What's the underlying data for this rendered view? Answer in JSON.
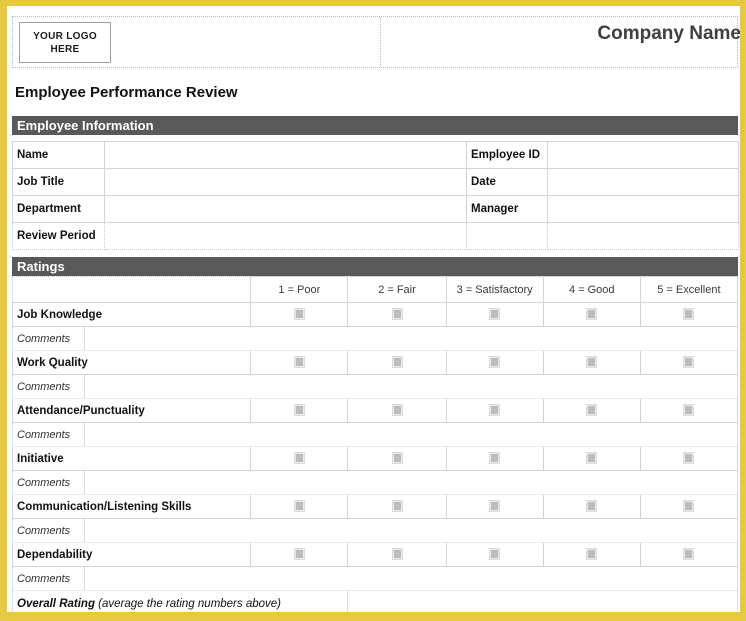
{
  "header": {
    "logo_placeholder_line1": "YOUR LOGO",
    "logo_placeholder_line2": "HERE",
    "company_name": "Company Name"
  },
  "document_title": "Employee Performance Review",
  "sections": {
    "employee_information": {
      "heading": "Employee Information",
      "rows": [
        {
          "left_label": "Name",
          "left_value": "",
          "right_label": "Employee ID",
          "right_value": ""
        },
        {
          "left_label": "Job Title",
          "left_value": "",
          "right_label": "Date",
          "right_value": ""
        },
        {
          "left_label": "Department",
          "left_value": "",
          "right_label": "Manager",
          "right_value": ""
        },
        {
          "left_label": "Review Period",
          "left_value": "",
          "right_label": "",
          "right_value": ""
        }
      ]
    },
    "ratings": {
      "heading": "Ratings",
      "scale": [
        "1 = Poor",
        "2 = Fair",
        "3 = Satisfactory",
        "4 = Good",
        "5 = Excellent"
      ],
      "comments_label": "Comments",
      "categories": [
        {
          "label": "Job Knowledge",
          "selected": null,
          "comment": ""
        },
        {
          "label": "Work Quality",
          "selected": null,
          "comment": ""
        },
        {
          "label": "Attendance/Punctuality",
          "selected": null,
          "comment": ""
        },
        {
          "label": "Initiative",
          "selected": null,
          "comment": ""
        },
        {
          "label": "Communication/Listening Skills",
          "selected": null,
          "comment": ""
        },
        {
          "label": "Dependability",
          "selected": null,
          "comment": ""
        }
      ],
      "overall": {
        "label": "Overall Rating",
        "note": "(average the rating numbers above)",
        "value": ""
      }
    }
  },
  "colors": {
    "page_border": "#e6c93f",
    "section_header_bg": "#595959",
    "section_header_text": "#ffffff",
    "checkbox": "#bdbdbd",
    "grid_line": "#d4d4d4"
  }
}
